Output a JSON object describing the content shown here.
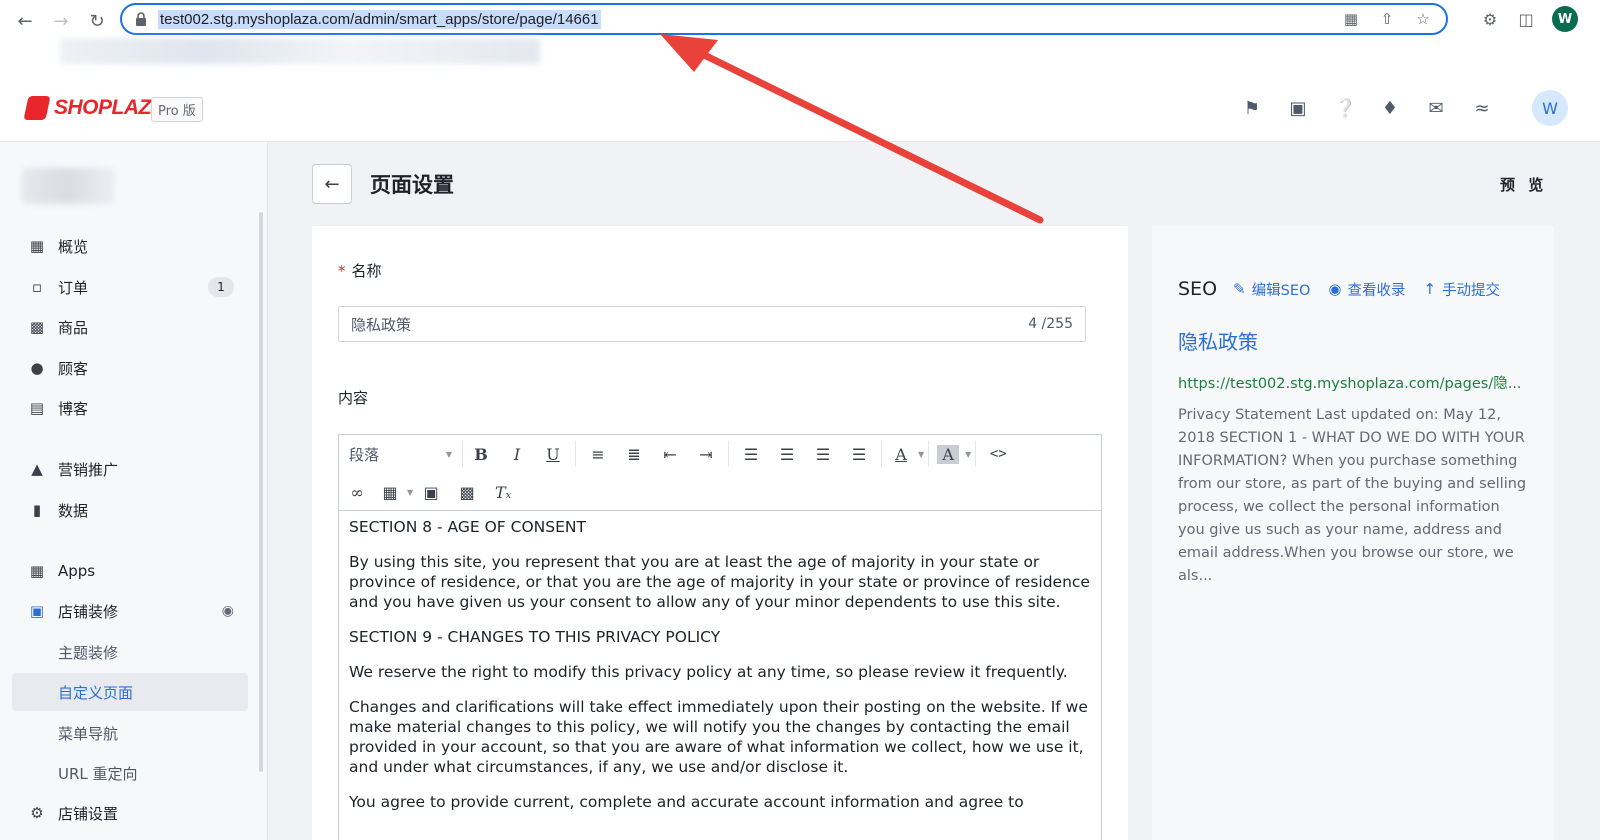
{
  "browser": {
    "url": "test002.stg.myshoplaza.com/admin/smart_apps/store/page/14661",
    "profile_initial": "W"
  },
  "header": {
    "logo_text": "SHOPLAZZA",
    "plan_badge": "Pro 版",
    "user_initial": "W"
  },
  "sidebar": {
    "items": [
      {
        "label": "概览",
        "icon": "overview-icon"
      },
      {
        "label": "订单",
        "icon": "orders-icon",
        "badge": "1"
      },
      {
        "label": "商品",
        "icon": "products-icon"
      },
      {
        "label": "顾客",
        "icon": "customers-icon"
      },
      {
        "label": "博客",
        "icon": "blog-icon"
      },
      {
        "label": "营销推广",
        "icon": "marketing-icon"
      },
      {
        "label": "数据",
        "icon": "analytics-icon"
      },
      {
        "label": "Apps",
        "icon": "apps-icon"
      },
      {
        "label": "店铺装修",
        "icon": "storefront-icon"
      },
      {
        "label": "主题装修"
      },
      {
        "label": "自定义页面"
      },
      {
        "label": "菜单导航"
      },
      {
        "label": "URL 重定向"
      },
      {
        "label": "店铺设置",
        "icon": "settings-icon"
      }
    ]
  },
  "page": {
    "title": "页面设置",
    "preview_label": "预 览"
  },
  "form": {
    "name_label": "名称",
    "name_required_mark": "*",
    "name_value": "隐私政策",
    "name_count": "4 /255",
    "content_label": "内容",
    "paragraph_select": "段落"
  },
  "editor": {
    "paragraphs": [
      "SECTION 8 - AGE OF CONSENT",
      "By using this site, you represent that you are at least the age of majority in your state or province of residence, or that you are the age of majority in your state or province of residence and you have given us your consent to allow any of your minor dependents to use this site.",
      "SECTION 9 - CHANGES TO THIS PRIVACY POLICY",
      "We reserve the right to modify this privacy policy at any time, so please review it frequently.",
      "Changes and clarifications will take effect immediately upon their posting on the website. If we make material changes to this policy, we will notify you the changes by contacting the email provided in your account, so that you are aware of what information we collect, how we use it, and under what circumstances, if any, we use and/or disclose it.",
      "You agree to provide current, complete and accurate account information and agree to"
    ]
  },
  "seo": {
    "title": "SEO",
    "edit_label": "编辑SEO",
    "view_label": "查看收录",
    "submit_label": "手动提交",
    "page_title": "隐私政策",
    "url": "https://test002.stg.myshoplaza.com/pages/隐...",
    "description": "Privacy Statement Last updated on: May 12, 2018 SECTION 1 - WHAT DO WE DO WITH YOUR INFORMATION? When you purchase something from our store, as part of the buying and selling process, we collect the personal information you give us such as your name, address and email address.When you browse our store, we als..."
  },
  "colors": {
    "accent": "#2b6fd6",
    "brand": "#e8262b",
    "annotation_arrow": "#e9423a",
    "url_link": "#1e7e3e"
  }
}
